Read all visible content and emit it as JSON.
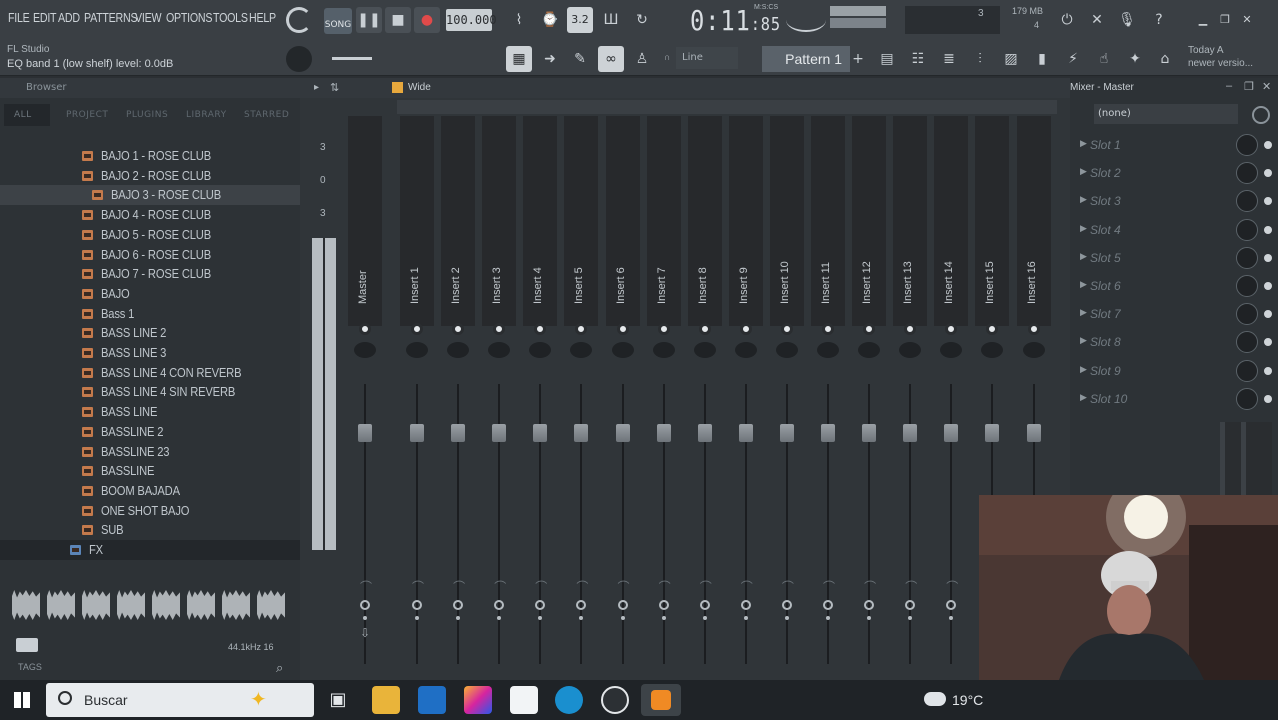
{
  "menu": [
    "FILE",
    "EDIT",
    "ADD",
    "PATTERNS",
    "VIEW",
    "OPTIONS",
    "TOOLS",
    "HELP"
  ],
  "transport": {
    "mode": "SONG",
    "tempo": "100.000",
    "time_main": "0:11",
    "time_sub": "85",
    "time_unit": "M:S:CS"
  },
  "hint": {
    "app": "FL Studio",
    "message": "EQ band 1 (low shelf) level: 0.0dB"
  },
  "monitor": {
    "memory": "179 MB",
    "cpu_val": "3",
    "voices": "4"
  },
  "toolbar2": {
    "snap": "Line",
    "pattern": "Pattern 1",
    "news_line1": "Today  A",
    "news_line2": "newer versio..."
  },
  "browser": {
    "title": "Browser",
    "tabs": [
      "ALL",
      "PROJECT",
      "PLUGINS",
      "LIBRARY",
      "STARRED"
    ],
    "items": [
      {
        "label": "BAJO 1 - ROSE CLUB"
      },
      {
        "label": "BAJO 2 - ROSE CLUB"
      },
      {
        "label": "BAJO 3 - ROSE CLUB"
      },
      {
        "label": "BAJO 4 - ROSE CLUB"
      },
      {
        "label": "BAJO 5 - ROSE CLUB"
      },
      {
        "label": "BAJO 6 - ROSE CLUB"
      },
      {
        "label": "BAJO 7 - ROSE CLUB"
      },
      {
        "label": "BAJO"
      },
      {
        "label": "Bass 1"
      },
      {
        "label": "BASS LINE 2"
      },
      {
        "label": "BASS LINE 3"
      },
      {
        "label": "BASS LINE 4 CON REVERB"
      },
      {
        "label": "BASS LINE 4 SIN REVERB"
      },
      {
        "label": "BASS LINE"
      },
      {
        "label": "BASSLINE 2"
      },
      {
        "label": "BASSLINE 23"
      },
      {
        "label": "BASSLINE"
      },
      {
        "label": "BOOM BAJADA"
      },
      {
        "label": "ONE SHOT BAJO"
      },
      {
        "label": "SUB"
      },
      {
        "label": "FX"
      }
    ],
    "samplerate": "44.1kHz 16",
    "tags": "TAGS"
  },
  "mixer": {
    "view": "Wide",
    "meter_scale": [
      "3",
      "0",
      "3"
    ],
    "master_label": "Master",
    "inserts": [
      "Insert 1",
      "Insert 2",
      "Insert 3",
      "Insert 4",
      "Insert 5",
      "Insert 6",
      "Insert 7",
      "Insert 8",
      "Insert 9",
      "Insert 10",
      "Insert 11",
      "Insert 12",
      "Insert 13",
      "Insert 14",
      "Insert 15",
      "Insert 16"
    ]
  },
  "mixpanel": {
    "title": "Mixer - Master",
    "preset": "(none)",
    "slots": [
      "Slot 1",
      "Slot 2",
      "Slot 3",
      "Slot 4",
      "Slot 5",
      "Slot 6",
      "Slot 7",
      "Slot 8",
      "Slot 9",
      "Slot 10"
    ]
  },
  "taskbar": {
    "search": "Buscar",
    "weather": "19°C"
  }
}
